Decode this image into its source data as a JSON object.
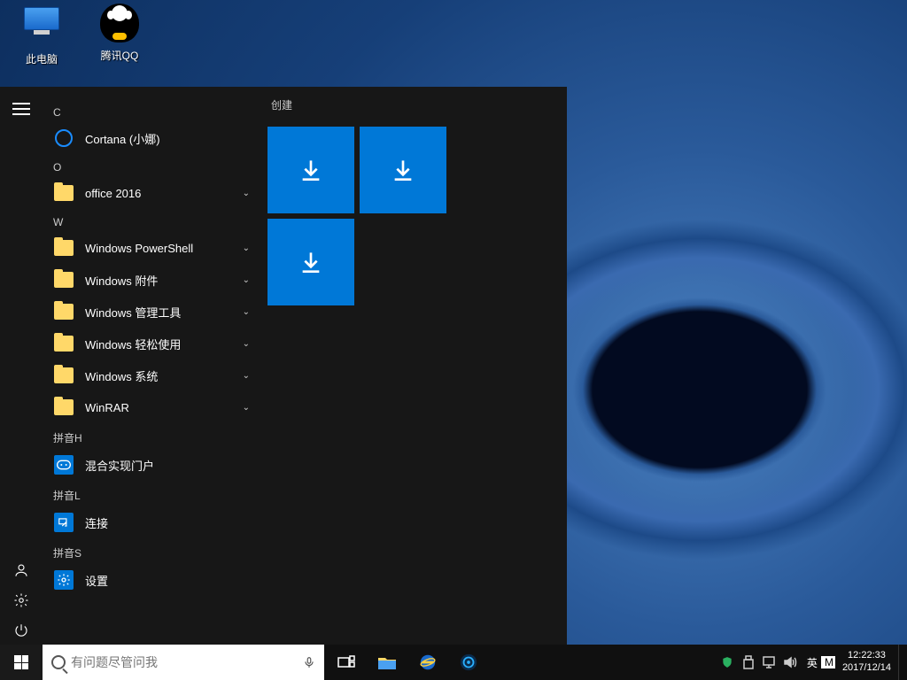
{
  "desktop": {
    "icons": {
      "computer": "此电脑",
      "qq": "腾讯QQ"
    }
  },
  "start_menu": {
    "sections": {
      "C": "C",
      "O": "O",
      "W": "W",
      "PH": "拼音H",
      "PL": "拼音L",
      "PS": "拼音S"
    },
    "apps": {
      "cortana": "Cortana (小娜)",
      "office": "office 2016",
      "powershell": "Windows PowerShell",
      "accessories": "Windows 附件",
      "admin": "Windows 管理工具",
      "ease": "Windows 轻松使用",
      "system": "Windows 系统",
      "winrar": "WinRAR",
      "mixedreality": "混合实现门户",
      "connect": "连接",
      "settings": "设置"
    },
    "tiles_header": "创建"
  },
  "taskbar": {
    "search_placeholder": "有问题尽管问我",
    "ime_lang": "英",
    "ime_ind": "M",
    "time": "12:22:33",
    "date": "2017/12/14"
  }
}
